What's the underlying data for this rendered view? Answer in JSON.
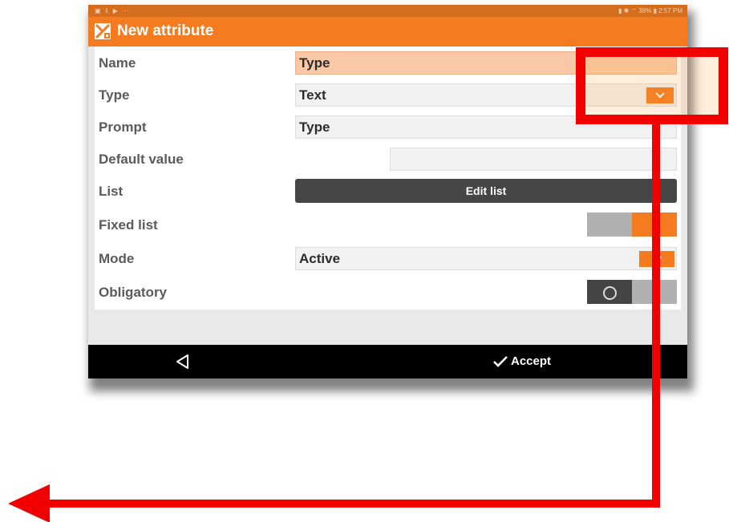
{
  "statusbar": {
    "left_icons": "▣ ⇩ ▶ ···",
    "right_text": "▮ ✱ ⌔ 38% ▮ 2:57 PM"
  },
  "appbar": {
    "logo_icon": "app-logo-icon",
    "title": "New attribute"
  },
  "form": {
    "rows": [
      {
        "label": "Name",
        "value": "Type"
      },
      {
        "label": "Type",
        "value": "Text"
      },
      {
        "label": "Prompt",
        "value": "Type"
      },
      {
        "label": "Default value",
        "value": ""
      },
      {
        "label": "List",
        "button": "Edit list"
      },
      {
        "label": "Fixed list",
        "toggle": "on"
      },
      {
        "label": "Mode",
        "value": "Active"
      },
      {
        "label": "Obligatory",
        "toggle": "off"
      }
    ]
  },
  "navbar": {
    "back_icon": "back-triangle-icon",
    "accept_label": "Accept"
  },
  "colors": {
    "accent": "#f47b20",
    "highlight": "#f20000",
    "dark_button": "#464646"
  }
}
